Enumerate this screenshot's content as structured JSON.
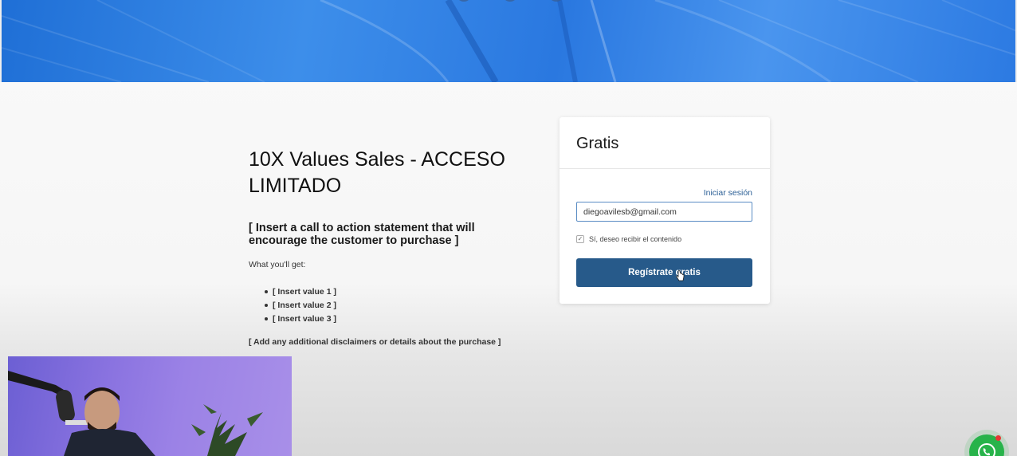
{
  "product": {
    "title": "10X Values Sales - ACCESO LIMITADO",
    "cta": "[ Insert a call to action statement that will encourage the customer to purchase ]",
    "what_you_get_label": "What you'll get:",
    "values": [
      "[ Insert value 1 ]",
      "[ Insert value 2 ]",
      "[ Insert value 3 ]"
    ],
    "disclaimer": "[ Add any additional disclaimers or details about the purchase ]"
  },
  "signup_card": {
    "title": "Gratis",
    "login_link": "Iniciar sesión",
    "email_value": "diegoavilesb@gmail.com",
    "consent_label": "Sí, deseo recibir el contenido",
    "consent_checked": true,
    "submit_label": "Regístrate gratis"
  },
  "colors": {
    "hero_blue": "#2c7ae2",
    "button_blue": "#275a8a",
    "link_blue": "#2b5f96",
    "whatsapp_green": "#27b34a"
  },
  "icons": {
    "checkbox": "check-icon",
    "floating_chat": "whatsapp-icon",
    "cursor": "hand-pointer-icon"
  }
}
